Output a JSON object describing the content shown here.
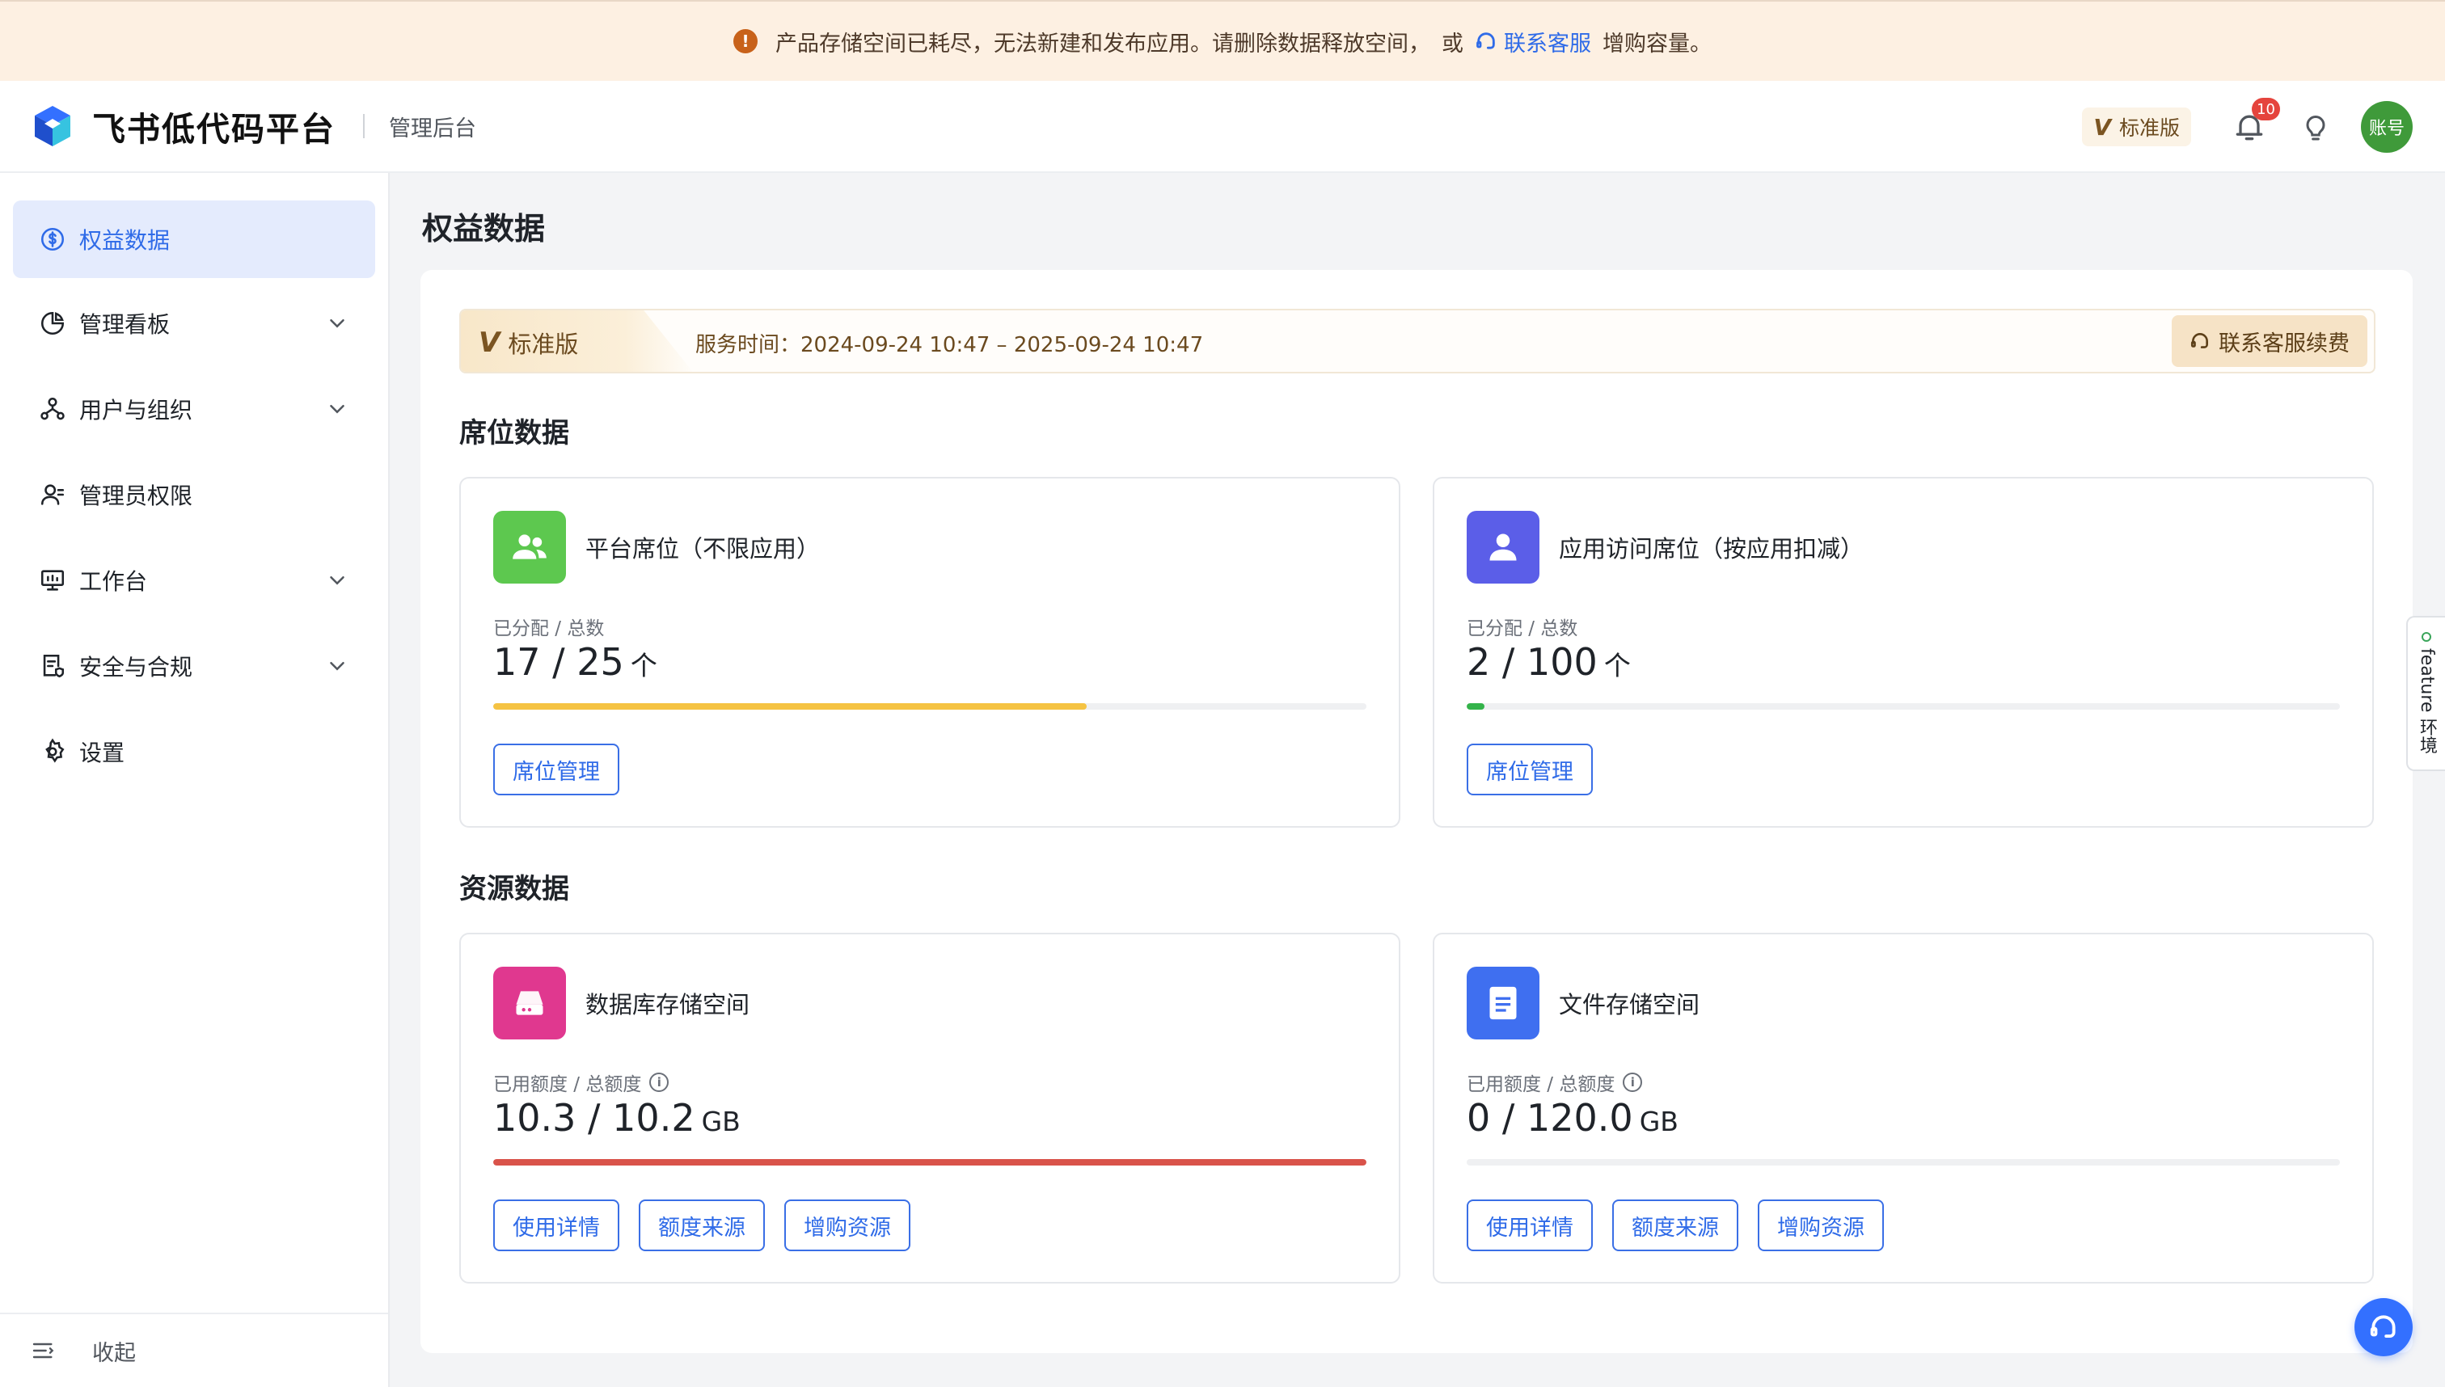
{
  "banner": {
    "message": "产品存储空间已耗尽，无法新建和发布应用。请删除数据释放空间，",
    "or_text": "或",
    "link_text": "联系客服",
    "suffix": "增购容量。",
    "warn_symbol": "!"
  },
  "header": {
    "brand_name": "飞书低代码平台",
    "subtitle": "管理后台",
    "edition_badge": "V",
    "edition_label": "标准版",
    "notification_count": "10",
    "avatar_text": "账号"
  },
  "sidebar": {
    "items": [
      {
        "label": "权益数据",
        "icon": "dollar-circle-icon",
        "active": true
      },
      {
        "label": "管理看板",
        "icon": "pie-chart-icon",
        "expandable": true
      },
      {
        "label": "用户与组织",
        "icon": "org-tree-icon",
        "expandable": true
      },
      {
        "label": "管理员权限",
        "icon": "admin-user-icon"
      },
      {
        "label": "工作台",
        "icon": "monitor-icon",
        "expandable": true
      },
      {
        "label": "安全与合规",
        "icon": "security-doc-icon",
        "expandable": true
      },
      {
        "label": "设置",
        "icon": "gear-icon"
      }
    ],
    "collapse_label": "收起"
  },
  "main": {
    "page_title": "权益数据",
    "plan": {
      "badge": "V",
      "name": "标准版",
      "service_time": "服务时间：2024-09-24 10:47 – 2025-09-24 10:47",
      "renew_button": "联系客服续费"
    },
    "seats": {
      "section_title": "席位数据",
      "cards": [
        {
          "title": "平台席位（不限应用）",
          "label": "已分配 / 总数",
          "value": "17 / 25",
          "unit": "个",
          "progress": 0.68,
          "color": "#f5c343",
          "icon_color": "#5dc84f",
          "icon": "users-icon",
          "button": "席位管理"
        },
        {
          "title": "应用访问席位（按应用扣减）",
          "label": "已分配 / 总数",
          "value": "2 / 100",
          "unit": "个",
          "progress": 0.02,
          "color": "#34b34a",
          "icon_color": "#5b5ee8",
          "icon": "user-icon",
          "button": "席位管理"
        }
      ]
    },
    "resources": {
      "section_title": "资源数据",
      "cards": [
        {
          "title": "数据库存储空间",
          "label": "已用额度 / 总额度",
          "info_symbol": "i",
          "value": "10.3 / 10.2",
          "unit": "GB",
          "progress": 1.0,
          "color": "#d9534a",
          "icon_color": "#e0388f",
          "icon": "database-icon",
          "buttons": [
            "使用详情",
            "额度来源",
            "增购资源"
          ]
        },
        {
          "title": "文件存储空间",
          "label": "已用额度 / 总额度",
          "info_symbol": "i",
          "value": "0 / 120.0",
          "unit": "GB",
          "progress": 0,
          "color": "#3370ff",
          "icon_color": "#3f6ff0",
          "icon": "file-icon",
          "buttons": [
            "使用详情",
            "额度来源",
            "增购资源"
          ]
        }
      ]
    }
  },
  "floating": {
    "feature_tab": "feature 环境"
  }
}
